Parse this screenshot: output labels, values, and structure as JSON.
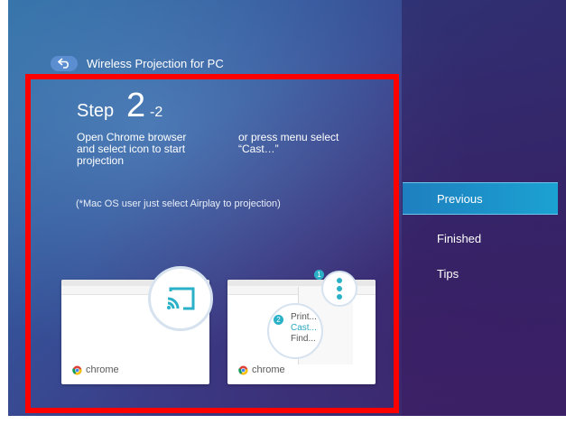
{
  "header": {
    "title": "Wireless Projection for PC",
    "back_icon": "back-arrow-icon"
  },
  "step": {
    "label": "Step",
    "number": "2",
    "sub": "-2",
    "instruction_left": "Open Chrome browser\nand select icon to start\nprojection",
    "instruction_right": "or press menu select\n“Cast…”",
    "note": "(*Mac OS user just select Airplay to projection)"
  },
  "illustrations": {
    "left_card_label": "chrome",
    "right_card_label": "chrome",
    "menu_print": "Print...",
    "menu_cast": "Cast...",
    "menu_find": "Find...",
    "badge_1": "1",
    "badge_2": "2"
  },
  "side_menu": {
    "previous": "Previous",
    "finished": "Finished",
    "tips": "Tips"
  },
  "colors": {
    "focus_frame": "#ff0000",
    "selected_item": "#1ba2d2",
    "accent": "#2ab1c8"
  }
}
